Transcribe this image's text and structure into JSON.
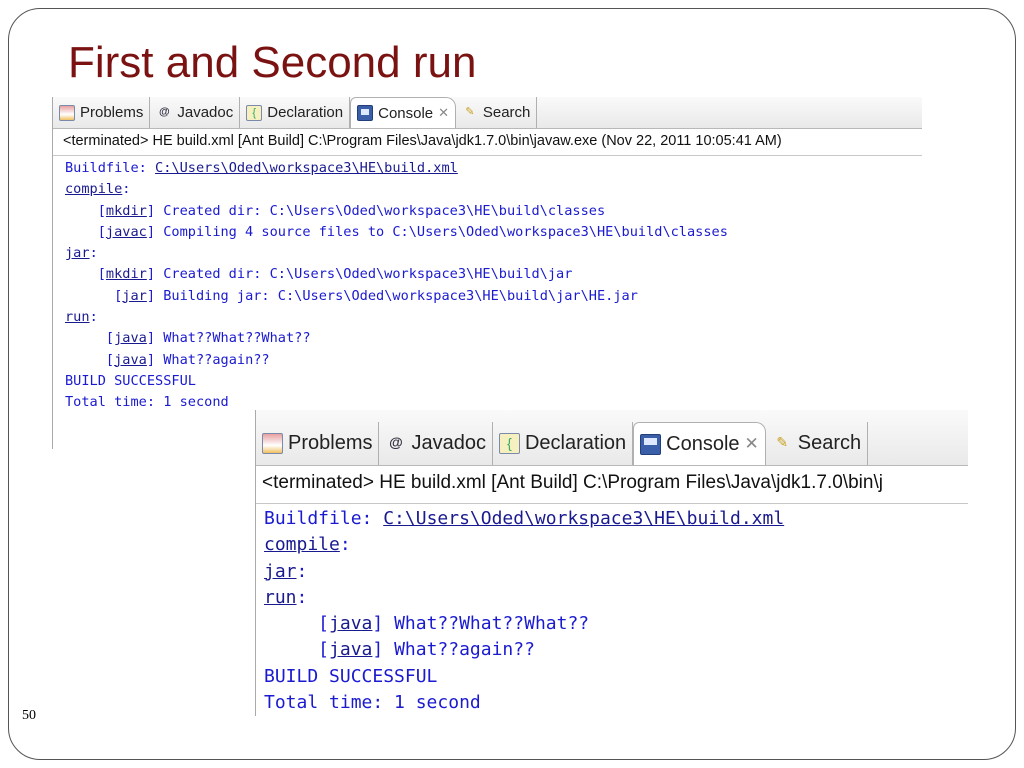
{
  "slide": {
    "title": "First and Second run",
    "page_number": "50"
  },
  "tabs": [
    {
      "label": "Problems",
      "icon": "problems-icon"
    },
    {
      "label": "Javadoc",
      "icon": "at-icon"
    },
    {
      "label": "Declaration",
      "icon": "declaration-icon"
    },
    {
      "label": "Console",
      "icon": "console-icon",
      "active": true
    },
    {
      "label": "Search",
      "icon": "search-icon"
    }
  ],
  "first_run": {
    "status": "<terminated> HE build.xml [Ant Build] C:\\Program Files\\Java\\jdk1.7.0\\bin\\javaw.exe (Nov 22, 2011 10:05:41 AM)",
    "lines": [
      {
        "pre": "Buildfile: ",
        "link": "C:\\Users\\Oded\\workspace3\\HE\\build.xml",
        "post": ""
      },
      {
        "pre": "",
        "link": "compile",
        "post": ":"
      },
      {
        "pre": "    [",
        "link": "mkdir",
        "post": "] Created dir: C:\\Users\\Oded\\workspace3\\HE\\build\\classes"
      },
      {
        "pre": "    [",
        "link": "javac",
        "post": "] Compiling 4 source files to C:\\Users\\Oded\\workspace3\\HE\\build\\classes"
      },
      {
        "pre": "",
        "link": "jar",
        "post": ":"
      },
      {
        "pre": "    [",
        "link": "mkdir",
        "post": "] Created dir: C:\\Users\\Oded\\workspace3\\HE\\build\\jar"
      },
      {
        "pre": "      [",
        "link": "jar",
        "post": "] Building jar: C:\\Users\\Oded\\workspace3\\HE\\build\\jar\\HE.jar"
      },
      {
        "pre": "",
        "link": "run",
        "post": ":"
      },
      {
        "pre": "     [",
        "link": "java",
        "post": "] What??What??What??"
      },
      {
        "pre": "     [",
        "link": "java",
        "post": "] What??again??"
      },
      {
        "pre": "BUILD SUCCESSFUL",
        "link": "",
        "post": ""
      },
      {
        "pre": "Total time: 1 second",
        "link": "",
        "post": ""
      }
    ]
  },
  "second_run": {
    "status": "<terminated> HE build.xml [Ant Build] C:\\Program Files\\Java\\jdk1.7.0\\bin\\j",
    "lines": [
      {
        "pre": "Buildfile: ",
        "link": "C:\\Users\\Oded\\workspace3\\HE\\build.xml",
        "post": ""
      },
      {
        "pre": "",
        "link": "compile",
        "post": ":"
      },
      {
        "pre": "",
        "link": "jar",
        "post": ":"
      },
      {
        "pre": "",
        "link": "run",
        "post": ":"
      },
      {
        "pre": "     [",
        "link": "java",
        "post": "] What??What??What??"
      },
      {
        "pre": "     [",
        "link": "java",
        "post": "] What??again??"
      },
      {
        "pre": "BUILD SUCCESSFUL",
        "link": "",
        "post": ""
      },
      {
        "pre": "Total time: 1 second",
        "link": "",
        "post": ""
      }
    ]
  }
}
